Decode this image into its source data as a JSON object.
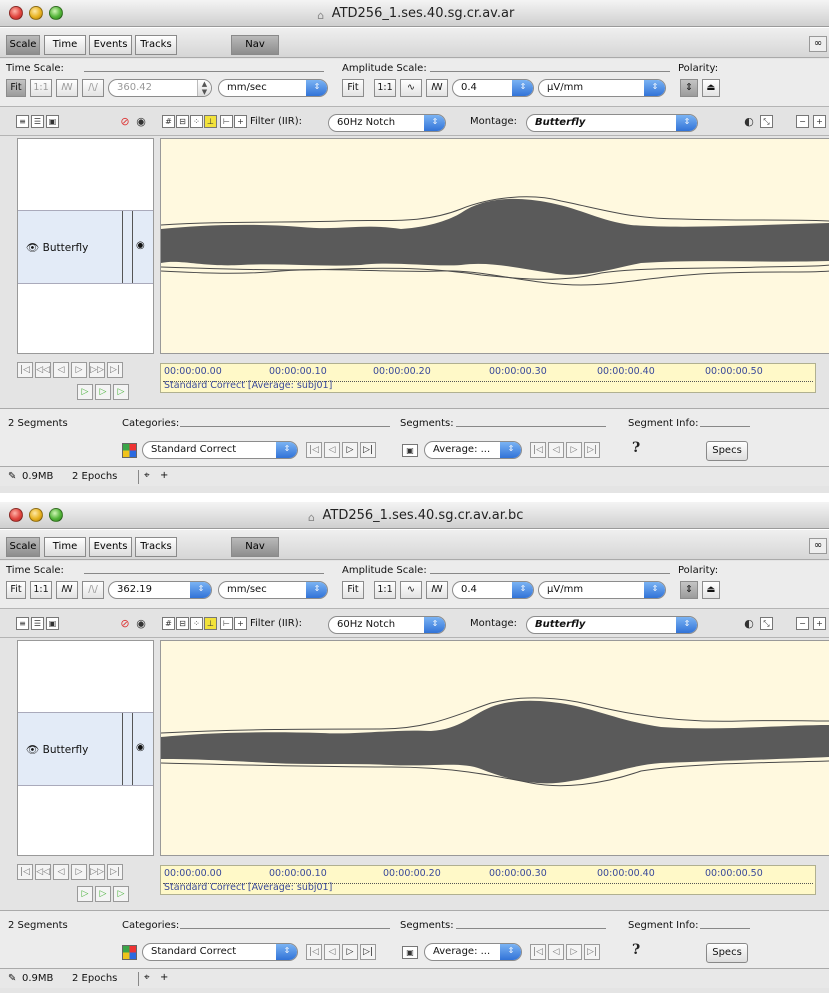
{
  "windows": [
    {
      "title": "ATD256_1.ses.40.sg.cr.av.ar",
      "tabs": [
        "Scale",
        "Time",
        "Events",
        "Tracks",
        "Nav"
      ],
      "time_scale_label": "Time Scale:",
      "time_fit": "Fit",
      "time_one_to_one": "1:1",
      "time_value": "360.42",
      "time_unit": "mm/sec",
      "amplitude_label": "Amplitude Scale:",
      "amp_fit": "Fit",
      "amp_one_to_one": "1:1",
      "amp_value": "0.4",
      "amp_unit": "µV/mm",
      "polarity_label": "Polarity:",
      "filter_label": "Filter (IIR):",
      "filter_value": "60Hz Notch",
      "montage_label": "Montage:",
      "montage_value": "Butterfly",
      "track_label": "Butterfly",
      "timeline_ticks": [
        "00:00:00.00",
        "00:00:00.10",
        "00:00:00.20",
        "00:00:00.30",
        "00:00:00.40",
        "00:00:00.50"
      ],
      "timeline_caption": "Standard Correct [Average: subj01]",
      "segments_count": "2 Segments",
      "categories_label": "Categories:",
      "category_value": "Standard Correct",
      "segments_label": "Segments:",
      "segment_value": "Average: ...",
      "segment_info_label": "Segment Info:",
      "question": "?",
      "specs_label": "Specs",
      "memory": "0.9MB",
      "epochs": "2 Epochs"
    },
    {
      "title": "ATD256_1.ses.40.sg.cr.av.ar.bc",
      "tabs": [
        "Scale",
        "Time",
        "Events",
        "Tracks",
        "Nav"
      ],
      "time_scale_label": "Time Scale:",
      "time_fit": "Fit",
      "time_one_to_one": "1:1",
      "time_value": "362.19",
      "time_unit": "mm/sec",
      "amplitude_label": "Amplitude Scale:",
      "amp_fit": "Fit",
      "amp_one_to_one": "1:1",
      "amp_value": "0.4",
      "amp_unit": "µV/mm",
      "polarity_label": "Polarity:",
      "filter_label": "Filter (IIR):",
      "filter_value": "60Hz Notch",
      "montage_label": "Montage:",
      "montage_value": "Butterfly",
      "track_label": "Butterfly",
      "timeline_ticks": [
        "00:00:00.00",
        "00:00:00.10",
        "00:00:00.20",
        "00:00:00.30",
        "00:00:00.40",
        "00:00:00.50"
      ],
      "timeline_caption": "Standard Correct [Average: subj01]",
      "segments_count": "2 Segments",
      "categories_label": "Categories:",
      "category_value": "Standard Correct",
      "segments_label": "Segments:",
      "segment_value": "Average: ...",
      "segment_info_label": "Segment Info:",
      "question": "?",
      "specs_label": "Specs",
      "memory": "0.9MB",
      "epochs": "2 Epochs"
    }
  ],
  "colors": {
    "waveform": "#5a5a5a",
    "plot_bg": "#fff9df",
    "timeline_bg": "#fff9c8",
    "accent": "#2d6fd6"
  }
}
